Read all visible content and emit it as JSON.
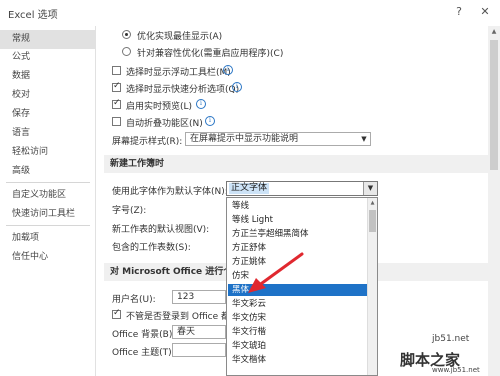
{
  "window": {
    "title": "Excel 选项",
    "help_glyph": "?",
    "close_glyph": "✕"
  },
  "sidebar": {
    "items": [
      {
        "label": "常规",
        "selected": true
      },
      {
        "label": "公式"
      },
      {
        "label": "数据"
      },
      {
        "label": "校对"
      },
      {
        "label": "保存"
      },
      {
        "label": "语言"
      },
      {
        "label": "轻松访问"
      },
      {
        "label": "高级"
      },
      {
        "label": "自定义功能区"
      },
      {
        "label": "快速访问工具栏"
      },
      {
        "label": "加载项"
      },
      {
        "label": "信任中心"
      }
    ]
  },
  "ui_options": {
    "radio_best_appearance": "优化实现最佳显示(A)",
    "radio_compat": "针对兼容性优化(需重启应用程序)(C)",
    "show_mini_toolbar": "选择时显示浮动工具栏(M)",
    "show_quick_analysis": "选择时显示快速分析选项(Q)",
    "enable_live_preview": "启用实时预览(L)",
    "collapse_ribbon": "自动折叠功能区(N)",
    "screentip_label": "屏幕提示样式(R):",
    "screentip_value": "在屏幕提示中显示功能说明"
  },
  "new_workbook": {
    "section_title": "新建工作簿时",
    "font_label": "使用此字体作为默认字体(N):",
    "font_value": "正文字体",
    "size_label": "字号(Z):",
    "default_view_label": "新工作表的默认视图(V):",
    "sheets_label": "包含的工作表数(S):"
  },
  "personalize": {
    "section_title": "对 Microsoft Office 进行个性化设置",
    "username_label": "用户名(U):",
    "username_value": "123",
    "always_use_label": "不管是否登录到 Office 都始终使用这些值(A)",
    "background_label": "Office 背景(B):",
    "background_value": "春天",
    "theme_label": "Office 主题(T):"
  },
  "font_dropdown": {
    "items": [
      "等线",
      "等线 Light",
      "方正兰亭超细黑简体",
      "方正舒体",
      "方正姚体",
      "仿宋",
      "黑体",
      "华文彩云",
      "华文仿宋",
      "华文行楷",
      "华文琥珀",
      "华文楷体"
    ],
    "highlighted": "黑体"
  },
  "colors": {
    "highlight": "#1e72c7",
    "selection_bg": "#cde3f7",
    "arrow": "#e0282f"
  },
  "watermark": {
    "site": "jb51.net",
    "name": "脚本之家",
    "url": "www.jb51.net"
  }
}
